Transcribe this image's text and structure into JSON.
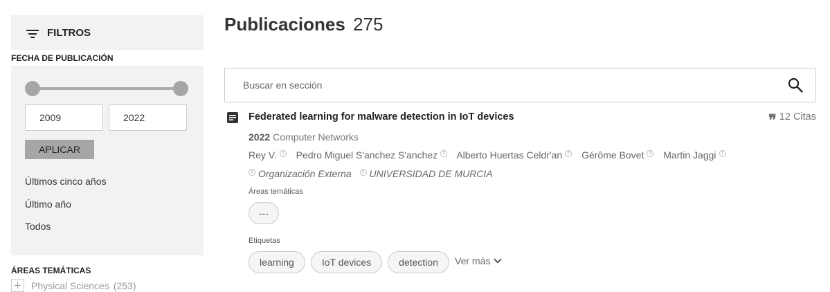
{
  "sidebar": {
    "filters_title": "FILTROS",
    "date_section_label": "FECHA DE PUBLICACIÓN",
    "year_from": "2009",
    "year_to": "2022",
    "apply_label": "APLICAR",
    "quick_ranges": [
      "Últimos cinco años",
      "Último año",
      "Todos"
    ],
    "areas_section_label": "ÁREAS TEMÁTICAS",
    "areas": [
      {
        "name": "Physical Sciences",
        "count": "(253)"
      }
    ]
  },
  "main": {
    "title": "Publicaciones",
    "count": "275",
    "search_placeholder": "Buscar en sección",
    "publication": {
      "title": "Federated learning for malware detection in IoT devices",
      "citations": "12 Citas",
      "year": "2022",
      "journal": "Computer Networks",
      "authors": [
        {
          "name": "Rey V.",
          "affiliation": "1"
        },
        {
          "name": "Pedro Miguel S'anchez S'anchez",
          "affiliation": "2"
        },
        {
          "name": "Alberto Huertas Celdr'an",
          "affiliation": "2"
        },
        {
          "name": "Gérôme Bovet",
          "affiliation": "1"
        },
        {
          "name": "Martin Jaggi",
          "affiliation": "1"
        }
      ],
      "organizations": [
        {
          "name": "Organización Externa",
          "number": "1"
        },
        {
          "name": "UNIVERSIDAD DE MURCIA",
          "number": "2"
        }
      ],
      "areas_label": "Áreas temáticas",
      "areas_placeholder": "---",
      "tags_label": "Etiquetas",
      "tags": [
        "learning",
        "IoT devices",
        "detection"
      ],
      "more_label": "Ver más"
    }
  },
  "icons": {
    "filter": "filter-lines-icon",
    "search": "magnifier-icon",
    "document": "document-icon",
    "quote": "quote-icon",
    "chevron": "chevron-down-icon",
    "expand": "plus-box-icon"
  }
}
